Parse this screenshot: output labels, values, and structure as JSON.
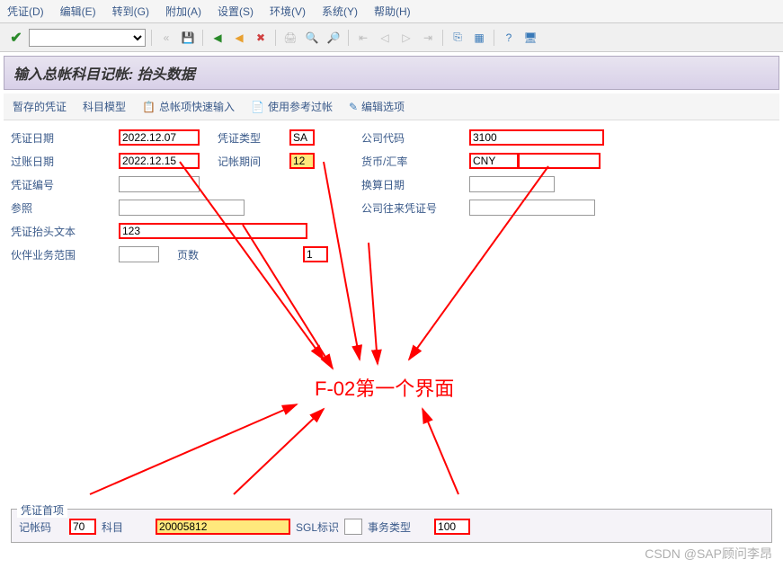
{
  "menu": {
    "voucher": "凭证(D)",
    "edit": "编辑(E)",
    "goto": "转到(G)",
    "attach": "附加(A)",
    "settings": "设置(S)",
    "env": "环境(V)",
    "system": "系统(Y)",
    "help": "帮助(H)"
  },
  "title": "输入总帐科目记帐: 抬头数据",
  "subtoolbar": {
    "saved_voucher": "暂存的凭证",
    "account_model": "科目模型",
    "fast_entry": "总帐项快速输入",
    "use_ref": "使用参考过帐",
    "edit_options": "编辑选项"
  },
  "form": {
    "voucher_date_lbl": "凭证日期",
    "voucher_date": "2022.12.07",
    "voucher_type_lbl": "凭证类型",
    "voucher_type": "SA",
    "company_code_lbl": "公司代码",
    "company_code": "3100",
    "posting_date_lbl": "过账日期",
    "posting_date": "2022.12.15",
    "period_lbl": "记帐期间",
    "period": "12",
    "currency_lbl": "货币/汇率",
    "currency": "CNY",
    "currency_rate": "",
    "voucher_no_lbl": "凭证编号",
    "voucher_no": "",
    "trans_date_lbl": "换算日期",
    "trans_date": "",
    "reference_lbl": "参照",
    "reference": "",
    "intercompany_lbl": "公司往来凭证号",
    "intercompany": "",
    "header_text_lbl": "凭证抬头文本",
    "header_text": "123",
    "partner_seg_lbl": "伙伴业务范围",
    "partner_seg": "",
    "pages_lbl": "页数",
    "pages": "1"
  },
  "annotation": "F-02第一个界面",
  "footer": {
    "group_title": "凭证首项",
    "posting_key_lbl": "记帐码",
    "posting_key": "70",
    "account_lbl": "科目",
    "account": "20005812",
    "sgl_lbl": "SGL标识",
    "sgl": "",
    "trans_type_lbl": "事务类型",
    "trans_type": "100"
  },
  "watermark": "CSDN @SAP顾问李昂"
}
